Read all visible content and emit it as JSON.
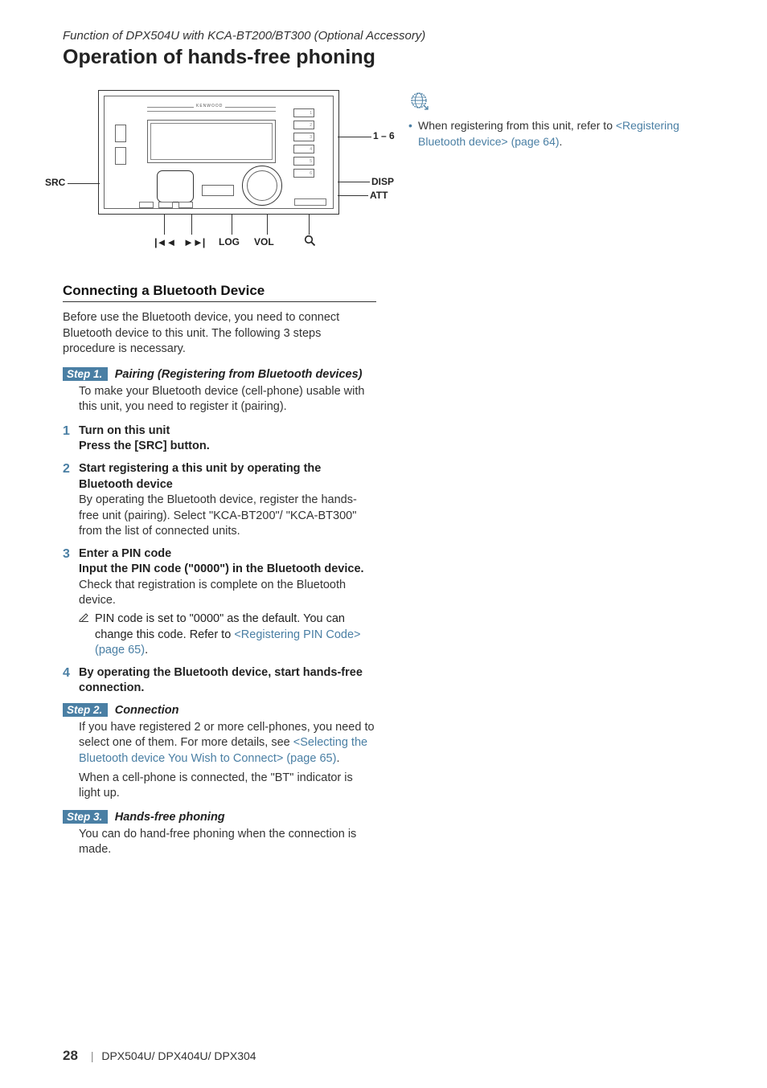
{
  "supertitle": "Function of DPX504U with KCA-BT200/BT300 (Optional Accessory)",
  "title": "Operation of hands-free phoning",
  "device": {
    "brand": "KENWOOD",
    "callouts": {
      "left": "SRC",
      "right_top": "1 – 6",
      "right_mid": "DISP",
      "right_low": "ATT",
      "bottom_prev": "◄◄",
      "bottom_next": "►►",
      "bottom_log": "LOG",
      "bottom_vol": "VOL",
      "bottom_search_alt": "🔍"
    }
  },
  "section_heading": "Connecting a Bluetooth Device",
  "intro": "Before use the Bluetooth device, you need to connect Bluetooth device to this unit. The following 3 steps procedure is necessary.",
  "step1": {
    "label": "Step 1.",
    "title": "Pairing (Registering from Bluetooth devices)",
    "desc": "To make your Bluetooth device (cell-phone) usable with this unit, you need to register it (pairing).",
    "items": [
      {
        "num": "1",
        "strong": "Turn on this unit",
        "strong2": "Press the [SRC] button."
      },
      {
        "num": "2",
        "strong": "Start registering a this unit by operating the Bluetooth device",
        "sub": "By operating the Bluetooth device, register the hands-free unit (pairing). Select \"KCA-BT200\"/ \"KCA-BT300\" from the list of connected units."
      },
      {
        "num": "3",
        "strong": "Enter a PIN code",
        "strong2": "Input the PIN code (\"0000\") in the Bluetooth device.",
        "sub": "Check that registration is complete on the Bluetooth device.",
        "note_pre": "PIN code is set to \"0000\" as the default. You can change this code. Refer to ",
        "note_link": "<Registering PIN Code> (page 65)",
        "note_post": "."
      },
      {
        "num": "4",
        "strong": "By operating the Bluetooth device, start hands-free connection."
      }
    ]
  },
  "step2": {
    "label": "Step 2.",
    "title": "Connection",
    "pre": "If you have registered 2 or more cell-phones, you need to select one of them. For more details, see ",
    "link": "<Selecting the Bluetooth device You Wish to Connect> (page 65)",
    "post": ".",
    "after": "When a cell-phone is connected, the \"BT\" indicator is light up."
  },
  "step3": {
    "label": "Step 3.",
    "title": "Hands-free phoning",
    "desc": "You can do hand-free phoning when the connection is made."
  },
  "right": {
    "bullet_pre": "When registering from this unit, refer to ",
    "bullet_link": "<Registering Bluetooth device> (page 64)",
    "bullet_post": "."
  },
  "footer": {
    "page": "28",
    "models": "DPX504U/ DPX404U/ DPX304"
  }
}
